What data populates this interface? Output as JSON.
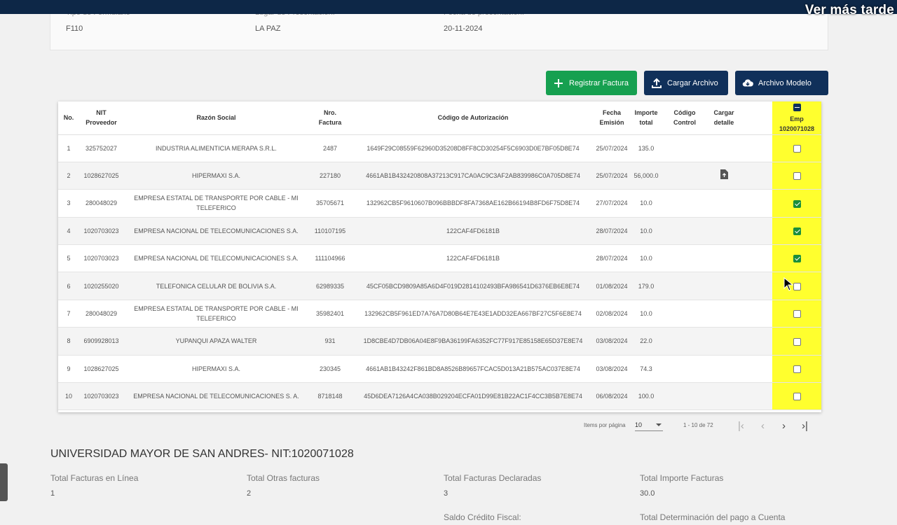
{
  "overlay": {
    "ver_mas_tarde": "Ver más tarde"
  },
  "form_info": {
    "fields": [
      {
        "label": "Tipo de Formulario",
        "value": "F110"
      },
      {
        "label": "Lugar de Presentación:",
        "value": "LA PAZ"
      },
      {
        "label": "Fecha de presentación:",
        "value": "20-11-2024"
      }
    ]
  },
  "actions": {
    "registrar": "Registrar Factura",
    "cargar": "Cargar Archivo",
    "modelo": "Archivo Modelo"
  },
  "table": {
    "headers": {
      "no": "No.",
      "nit_line1": "NIT",
      "nit_line2": "Proveedor",
      "razon": "Razón Social",
      "nro_line1": "Nro.",
      "nro_line2": "Factura",
      "codigo": "Código de Autorización",
      "fecha_line1": "Fecha",
      "fecha_line2": "Emisión",
      "importe_line1": "Importe",
      "importe_line2": "total",
      "control_line1": "Código",
      "control_line2": "Control",
      "cargar_line1": "Cargar",
      "cargar_line2": "detalle",
      "emp_line1": "Emp",
      "emp_line2": "1020071028"
    },
    "rows": [
      {
        "no": "1",
        "nit": "325752027",
        "razon": "INDUSTRIA ALIMENTICIA MERAPA S.R.L.",
        "nro": "2487",
        "codigo": "1649F29C08559F62960D35208D8FF8CD30254F5C6903D0E7BF05D8E74",
        "fecha": "25/07/2024",
        "importe": "135.0",
        "control": "",
        "upload": false,
        "checked": false
      },
      {
        "no": "2",
        "nit": "1028627025",
        "razon": "HIPERMAXI S.A.",
        "nro": "227180",
        "codigo": "4661AB1B432420808A37213C917CA0AC9C3AF2AB839986C0A705D8E74",
        "fecha": "25/07/2024",
        "importe": "56,000.0",
        "control": "",
        "upload": true,
        "checked": false
      },
      {
        "no": "3",
        "nit": "280048029",
        "razon": "EMPRESA ESTATAL DE TRANSPORTE POR CABLE - MI TELEFERICO",
        "nro": "35705671",
        "codigo": "132962CB5F9610607B096BBBDF8FA7368AE162B66194B8FD6F75D8E74",
        "fecha": "27/07/2024",
        "importe": "10.0",
        "control": "",
        "upload": false,
        "checked": true
      },
      {
        "no": "4",
        "nit": "1020703023",
        "razon": "EMPRESA NACIONAL DE TELECOMUNICACIONES S.A.",
        "nro": "110107195",
        "codigo": "122CAF4FD6181B",
        "fecha": "28/07/2024",
        "importe": "10.0",
        "control": "",
        "upload": false,
        "checked": true
      },
      {
        "no": "5",
        "nit": "1020703023",
        "razon": "EMPRESA NACIONAL DE TELECOMUNICACIONES S.A.",
        "nro": "111104966",
        "codigo": "122CAF4FD6181B",
        "fecha": "28/07/2024",
        "importe": "10.0",
        "control": "",
        "upload": false,
        "checked": true
      },
      {
        "no": "6",
        "nit": "1020255020",
        "razon": "TELEFONICA CELULAR DE BOLIVIA S.A.",
        "nro": "62989335",
        "codigo": "45CF05BCD9809A85A6D4F019D2814102493BFA986541D6376EB6E8E74",
        "fecha": "01/08/2024",
        "importe": "179.0",
        "control": "",
        "upload": false,
        "checked": false
      },
      {
        "no": "7",
        "nit": "280048029",
        "razon": "EMPRESA ESTATAL DE TRANSPORTE POR CABLE - MI TELEFERICO",
        "nro": "35982401",
        "codigo": "132962CB5F961ED7A76A7D80B64E7E43E1ADD32EA667BF27C5F6E8E74",
        "fecha": "02/08/2024",
        "importe": "10.0",
        "control": "",
        "upload": false,
        "checked": false
      },
      {
        "no": "8",
        "nit": "6909928013",
        "razon": "YUPANQUI APAZA WALTER",
        "nro": "931",
        "codigo": "1D8CBE4D7DB06A04E8F9BA36199FA6352FC77F917E85158E65D37E8E74",
        "fecha": "03/08/2024",
        "importe": "22.0",
        "control": "",
        "upload": false,
        "checked": false
      },
      {
        "no": "9",
        "nit": "1028627025",
        "razon": "HIPERMAXI S.A.",
        "nro": "230345",
        "codigo": "4661AB1B43242F861BD8A8526B89657FCAC5D013A21B575AC037E8E74",
        "fecha": "03/08/2024",
        "importe": "74.3",
        "control": "",
        "upload": false,
        "checked": false
      },
      {
        "no": "10",
        "nit": "1020703023",
        "razon": "EMPRESA NACIONAL DE TELECOMUNICACIONES S. A.",
        "nro": "8718148",
        "codigo": "45D6DEA7126A4CA038B029204ECFA01D99E81B22AC1F4CC3B5B7E8E74",
        "fecha": "06/08/2024",
        "importe": "100.0",
        "control": "",
        "upload": false,
        "checked": false
      }
    ]
  },
  "pagination": {
    "items_label": "Items por página",
    "page_size": "10",
    "range": "1 - 10 de 72"
  },
  "summary": {
    "title": "UNIVERSIDAD MAYOR DE SAN ANDRES- NIT:1020071028",
    "items": [
      {
        "label": "Total Facturas en Línea",
        "value": "1"
      },
      {
        "label": "Total Otras facturas",
        "value": "2"
      },
      {
        "label": "Total Facturas Declaradas",
        "value": "3"
      },
      {
        "label": "Total Importe Facturas",
        "value": "30.0"
      },
      {
        "label": "Saldo Crédito Fiscal:",
        "value": ""
      },
      {
        "label": "Total Determinación del pago a Cuenta",
        "value": ""
      }
    ]
  },
  "colors": {
    "header_bar": "#0d2747",
    "green_button": "#16a050",
    "navy_button": "#10305a",
    "highlight": "#ffff2e",
    "checkbox_checked": "#1a8e3c"
  }
}
